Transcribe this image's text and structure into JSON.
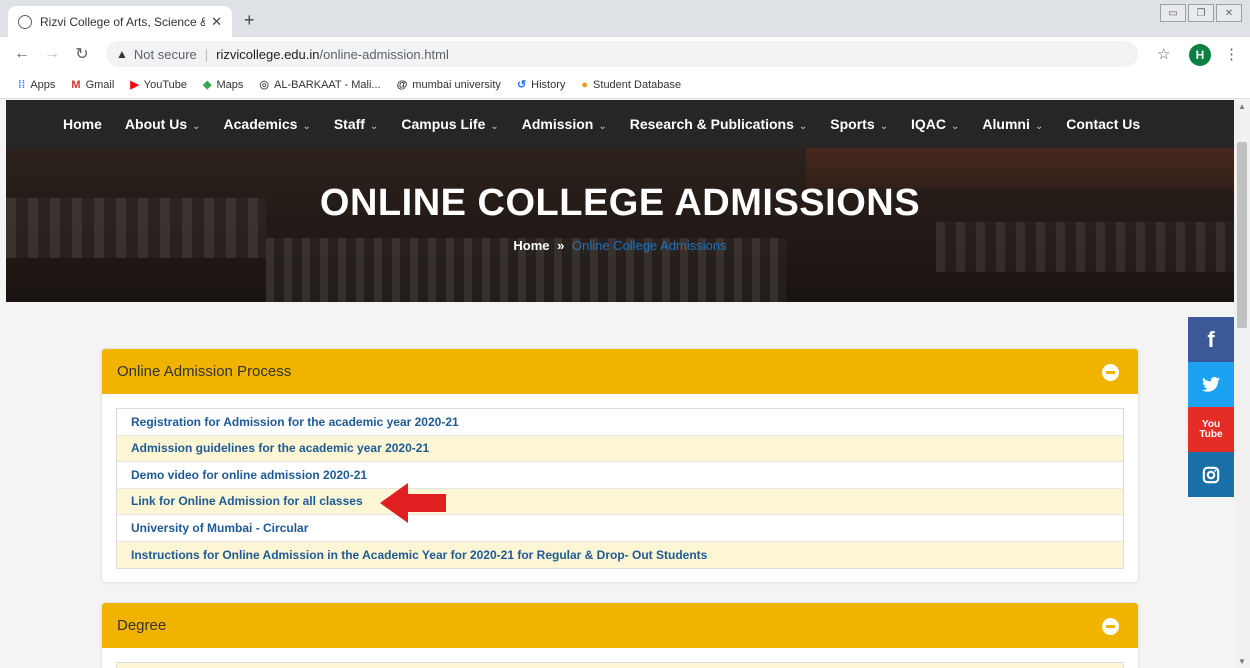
{
  "browser": {
    "tab_title": "Rizvi College of Arts, Science & C",
    "tab_close": "✕",
    "new_tab": "+",
    "not_secure": "Not secure",
    "url_host": "rizvicollege.edu.in",
    "url_path": "/online-admission.html",
    "profile_initial": "H",
    "bookmarks": [
      {
        "label": "Apps",
        "icon": "apps-grid-icon",
        "color": "#4285f4"
      },
      {
        "label": "Gmail",
        "icon": "gmail-icon",
        "color": "#d93025"
      },
      {
        "label": "YouTube",
        "icon": "youtube-icon",
        "color": "#ff0000"
      },
      {
        "label": "Maps",
        "icon": "maps-pin-icon",
        "color": "#34a853"
      },
      {
        "label": "AL-BARKAAT - Mali...",
        "icon": "globe-icon",
        "color": "#5f6368"
      },
      {
        "label": "mumbai university",
        "icon": "at-icon",
        "color": "#202124"
      },
      {
        "label": "History",
        "icon": "history-icon",
        "color": "#1a73e8"
      },
      {
        "label": "Student Database",
        "icon": "database-icon",
        "color": "#f29900"
      }
    ]
  },
  "nav": {
    "items": [
      {
        "label": "Home",
        "has_dropdown": false
      },
      {
        "label": "About Us",
        "has_dropdown": true
      },
      {
        "label": "Academics",
        "has_dropdown": true
      },
      {
        "label": "Staff",
        "has_dropdown": true
      },
      {
        "label": "Campus Life",
        "has_dropdown": true
      },
      {
        "label": "Admission",
        "has_dropdown": true
      },
      {
        "label": "Research & Publications",
        "has_dropdown": true
      },
      {
        "label": "Sports",
        "has_dropdown": true
      },
      {
        "label": "IQAC",
        "has_dropdown": true
      },
      {
        "label": "Alumni",
        "has_dropdown": true
      },
      {
        "label": "Contact Us",
        "has_dropdown": false
      }
    ]
  },
  "hero": {
    "title": "ONLINE COLLEGE ADMISSIONS",
    "breadcrumb_home": "Home",
    "breadcrumb_sep": "»",
    "breadcrumb_current": "Online College Admissions"
  },
  "social": {
    "facebook": "f",
    "youtube_top": "You",
    "youtube_bottom": "Tube"
  },
  "sections": [
    {
      "title": "Online Admission Process",
      "links": [
        "Registration for Admission for the academic year 2020-21",
        "Admission guidelines for the academic year 2020-21",
        "Demo video for online admission 2020-21",
        "Link for Online Admission for all classes",
        "University of Mumbai - Circular",
        "Instructions for Online Admission in the Academic Year for 2020-21 for Regular & Drop- Out Students"
      ]
    },
    {
      "title": "Degree",
      "links": []
    }
  ],
  "colors": {
    "accent_yellow": "#f0b400",
    "link_blue": "#1e5a96",
    "nav_bg": "#262626",
    "arrow_red": "#e02020"
  }
}
